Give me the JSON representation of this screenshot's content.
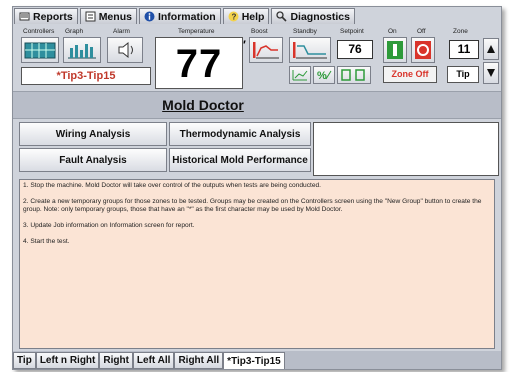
{
  "menubar": {
    "items": [
      {
        "label": "Reports",
        "icon": "reports-icon"
      },
      {
        "label": "Menus",
        "icon": "menus-icon"
      },
      {
        "label": "Information",
        "icon": "info-icon"
      },
      {
        "label": "Help",
        "icon": "help-icon"
      },
      {
        "label": "Diagnostics",
        "icon": "diagnostics-icon"
      }
    ]
  },
  "header": {
    "labels": {
      "controllers": "Controllers",
      "graph": "Graph",
      "alarm": "Alarm",
      "temperature": "Temperature",
      "boost": "Boost",
      "standby": "Standby",
      "setpoint": "Setpoint",
      "on": "On",
      "off": "Off",
      "zone": "Zone"
    },
    "temperature_value": "77",
    "setpoint_value": "76",
    "zone_value": "11",
    "zone_name": "Tip",
    "group_name": "*Tip3-Tip15",
    "zone_off_label": "Zone Off"
  },
  "page": {
    "title": "Mold Doctor"
  },
  "analysis": {
    "wiring": "Wiring Analysis",
    "thermo": "Thermodynamic Analysis",
    "fault": "Fault Analysis",
    "historical": "Historical Mold Performance"
  },
  "instructions": [
    "1. Stop the machine.  Mold Doctor will take over control of the outputs when tests are being conducted.",
    "2. Create a new temporary groups for those zones to be tested.  Groups may be created on the Controllers screen using the \"New Group\" button to create the group. Note: only temporary groups, those that have an \"*\" as the first character may be used by Mold Doctor.",
    "3. Update Job information on Information screen for report.",
    "4. Start the test."
  ],
  "tabs": [
    "Tip",
    "Left n Right",
    "Right",
    "Left All",
    "Right All",
    "*Tip3-Tip15"
  ],
  "colors": {
    "panel": "#cfd3db",
    "instructions_bg": "#fbe4d5",
    "on_green": "#2e9b3a",
    "off_red": "#d9342b",
    "group_red": "#c0392b"
  }
}
